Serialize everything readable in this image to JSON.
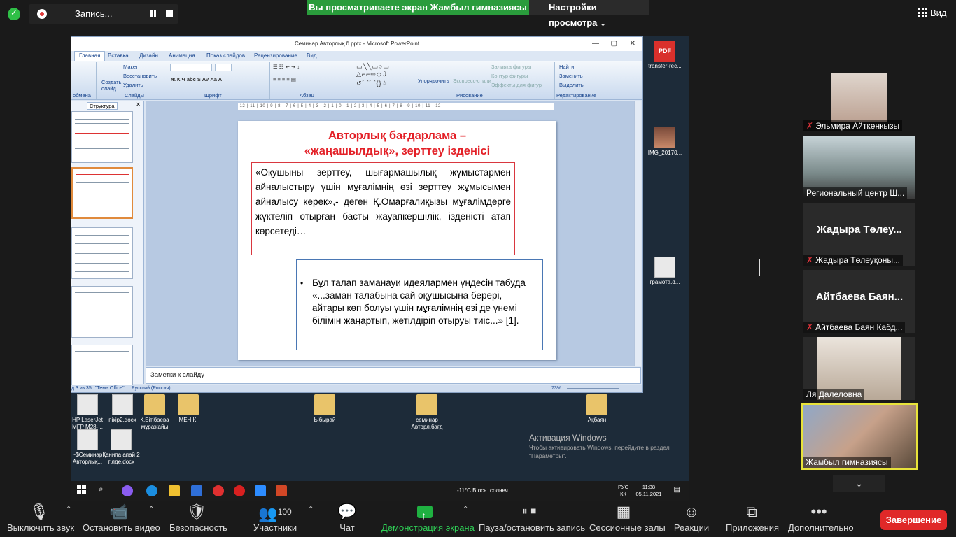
{
  "topbar": {
    "recording_label": "Запись...",
    "share_banner": "Вы просматриваете экран Жамбыл гимназиясы",
    "view_options": "Настройки просмотра",
    "view_button": "Вид"
  },
  "ppt": {
    "window_title": "Семинар Авторлық б.pptx - Microsoft PowerPoint",
    "tabs": [
      "Главная",
      "Вставка",
      "Дизайн",
      "Анимация",
      "Показ слайдов",
      "Рецензирование",
      "Вид"
    ],
    "ribbon": {
      "maket": "Макет",
      "restore": "Восстановить",
      "delete": "Удалить",
      "create_slide": "Создать слайд",
      "group_slides": "Слайды",
      "group_font": "Шрифт",
      "group_paragraph": "Абзац",
      "group_drawing": "Рисование",
      "group_editing": "Редактирование",
      "arrange": "Упорядочить",
      "express_styles": "Экспресс-стили",
      "shape_fill": "Заливка фигуры",
      "shape_outline": "Контур фигуры",
      "shape_effects": "Эффекты для фигур",
      "find": "Найти",
      "replace": "Заменить",
      "select": "Выделить",
      "clipboard_short": "обмена"
    },
    "pane_tab_structure": "Структура",
    "ruler_top": "·12·|·11·|·10·|·9·|·8·|·7·|·6·|·5·|·4·|·3·|·2·|·1·|·0·|·1·|·2·|·3·|·4·|·5·|·6·|·7·|·8·|·9·|·10·|·11·|·12·",
    "slide": {
      "title_line1": "Авторлық бағдарлама –",
      "title_line2": "«жаңашылдық», зерттеу ізденісі",
      "box1": "«Оқушыны зерттеу, шығармашылық жұмыстармен айналыстыру үшін мұғалімнің өзі зерттеу жұмысымен айналысу керек»,- деген Қ.Омарғалиқызы мұғалімдерге жүктеліп отырған басты жауапкершілік, ізденісті атап көрсетеді…",
      "box2": "Бұл талап заманауи идеялармен үндесін табуда «...заман талабына сай оқушысына берері, айтары көп болуы үшін мұғалімнің өзі де үнемі білімін жаңартып, жетілдіріп отыруы тиіс...»  [1]."
    },
    "notes_placeholder": "Заметки к слайду",
    "status": {
      "slide_count": "д 3 из 35",
      "theme": "\"Тема Office\"",
      "language": "Русский (Россия)",
      "zoom": "73%"
    }
  },
  "desktop": {
    "icons": [
      {
        "label": "transfer-rec...",
        "kind": "pdf"
      },
      {
        "label": "IMG_20170...",
        "kind": "photo"
      },
      {
        "label": "грамота.d...",
        "kind": "doc"
      },
      {
        "label": "HP LaserJet MFP M28-...",
        "kind": "doc"
      },
      {
        "label": "пікір2.docx",
        "kind": "doc"
      },
      {
        "label": "Қ.Бітібаева мұражайы",
        "kind": "folder"
      },
      {
        "label": "МЕНІКІ",
        "kind": "folder"
      },
      {
        "label": "Ыбырай",
        "kind": "folder"
      },
      {
        "label": "семинар Авторл.бағд",
        "kind": "folder"
      },
      {
        "label": "Ақбаян",
        "kind": "folder"
      },
      {
        "label": "~$Семинар Авторлық...",
        "kind": "doc"
      },
      {
        "label": "Қанипа апай 2 тілде.docx",
        "kind": "doc"
      }
    ],
    "activation_title": "Активация Windows",
    "activation_text": "Чтобы активировать Windows, перейдите в раздел \"Параметры\".",
    "pdf_badge": "PDF",
    "weather": "-11°C  В осн. солнеч...",
    "lang": "РУС",
    "lang2": "КК",
    "time": "11:38",
    "date": "05.11.2021"
  },
  "participants": [
    {
      "name": "Эльмира Айткенкызы",
      "muted": true,
      "video": true
    },
    {
      "name": "Региональный центр Ш...",
      "muted": false,
      "video": true
    },
    {
      "name": "Жадыра Төлеуқоны...",
      "display": "Жадыра Төлеу...",
      "muted": true,
      "video": false
    },
    {
      "name": "Айтбаева Баян Кабд...",
      "display": "Айтбаева Баян...",
      "muted": true,
      "video": false
    },
    {
      "name": "Ля Далеловна",
      "muted": false,
      "video": true
    },
    {
      "name": "Жамбыл гимназиясы",
      "muted": false,
      "video": true,
      "active": true
    }
  ],
  "toolbar": {
    "mute": "Выключить звук",
    "video": "Остановить видео",
    "security": "Безопасность",
    "participants": "Участники",
    "participants_count": "100",
    "chat": "Чат",
    "share": "Демонстрация экрана",
    "record": "Пауза/остановить запись",
    "breakout": "Сессионные залы",
    "reactions": "Реакции",
    "apps": "Приложения",
    "more": "Дополнительно",
    "end": "Завершение"
  },
  "colors": {
    "share_banner": "#2a9c3c",
    "end_button": "#e02828",
    "slide_title": "#e32027",
    "active_tile_border": "#e8e33a"
  }
}
